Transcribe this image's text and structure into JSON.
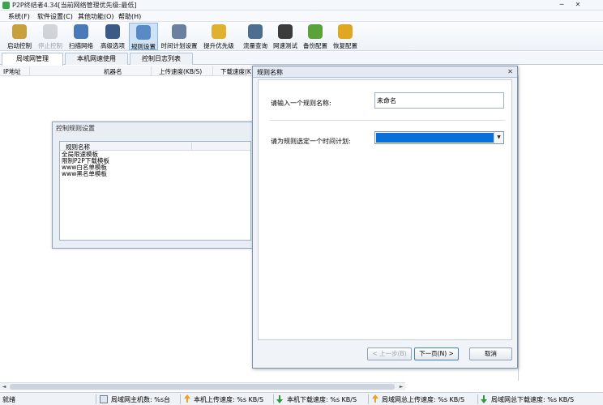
{
  "window": {
    "title": "P2P终结者4.34[当前网络管理优先级:最低]",
    "minimize": "─",
    "close": "✕"
  },
  "menu": [
    {
      "label": "系统(F)"
    },
    {
      "label": "软件设置(C)"
    },
    {
      "label": "其他功能(O)"
    },
    {
      "label": "帮助(H)"
    }
  ],
  "toolbar": [
    {
      "label": "启动控制",
      "icon": "start-control-icon",
      "color": "#c8a040",
      "state": "normal"
    },
    {
      "label": "停止控制",
      "icon": "stop-control-icon",
      "color": "#8a8f96",
      "state": "disabled"
    },
    {
      "label": "扫描网络",
      "icon": "scan-network-icon",
      "color": "#4a79b8",
      "state": "normal"
    },
    {
      "label": "高级选项",
      "icon": "advanced-options-icon",
      "color": "#3b5a86",
      "state": "normal"
    },
    {
      "label": "规则设置",
      "icon": "rule-settings-icon",
      "color": "#5a8ac6",
      "state": "active"
    },
    {
      "label": "时间计划设置",
      "icon": "time-plan-icon",
      "color": "#6b7fa0",
      "state": "normal"
    },
    {
      "label": "提升优先级",
      "icon": "raise-priority-icon",
      "color": "#e0b030",
      "state": "normal"
    },
    {
      "label": "流量查询",
      "icon": "traffic-query-icon",
      "color": "#4d6f8f",
      "state": "normal"
    },
    {
      "label": "网速测试",
      "icon": "speed-test-icon",
      "color": "#3c3c3c",
      "state": "normal"
    },
    {
      "label": "备份配置",
      "icon": "backup-config-icon",
      "color": "#5aa33a",
      "state": "normal"
    },
    {
      "label": "恢复配置",
      "icon": "restore-config-icon",
      "color": "#e0a820",
      "state": "normal"
    }
  ],
  "tabs": [
    {
      "label": "局域网管理",
      "active": true
    },
    {
      "label": "本机网速使用",
      "active": false
    },
    {
      "label": "控制日志列表",
      "active": false
    }
  ],
  "list_columns": [
    "IP地址",
    "机器名",
    "上传速度(KB/S)",
    "下载速度(K"
  ],
  "status": {
    "ready": "就绪",
    "lan_hosts": "局域网主机数: %s台",
    "local_upload": "本机上传速度: %s KB/S",
    "local_download": "本机下载速度: %s KB/S",
    "lan_upload": "局域网总上传速度: %s KB/S",
    "lan_download": "局域网总下载速度: %s KB/S"
  },
  "rules_dialog": {
    "title": "控制规则设置",
    "column": "规则名称",
    "rules": [
      "全局限速模板",
      "限制P2P下载模板",
      "www白名单模板",
      "www黑名单模板"
    ]
  },
  "wizard": {
    "title": "规则名称",
    "close": "✕",
    "name_label": "请输入一个规则名称:",
    "name_value": "未命名",
    "plan_label": "请为规则选定一个时间计划:",
    "plan_arrow": "▼",
    "prev_button": "< 上一步(B)",
    "next_button": "下一页(N) >",
    "cancel_button": "取消"
  },
  "scrollbar": {
    "left": "◄",
    "right": "►"
  }
}
